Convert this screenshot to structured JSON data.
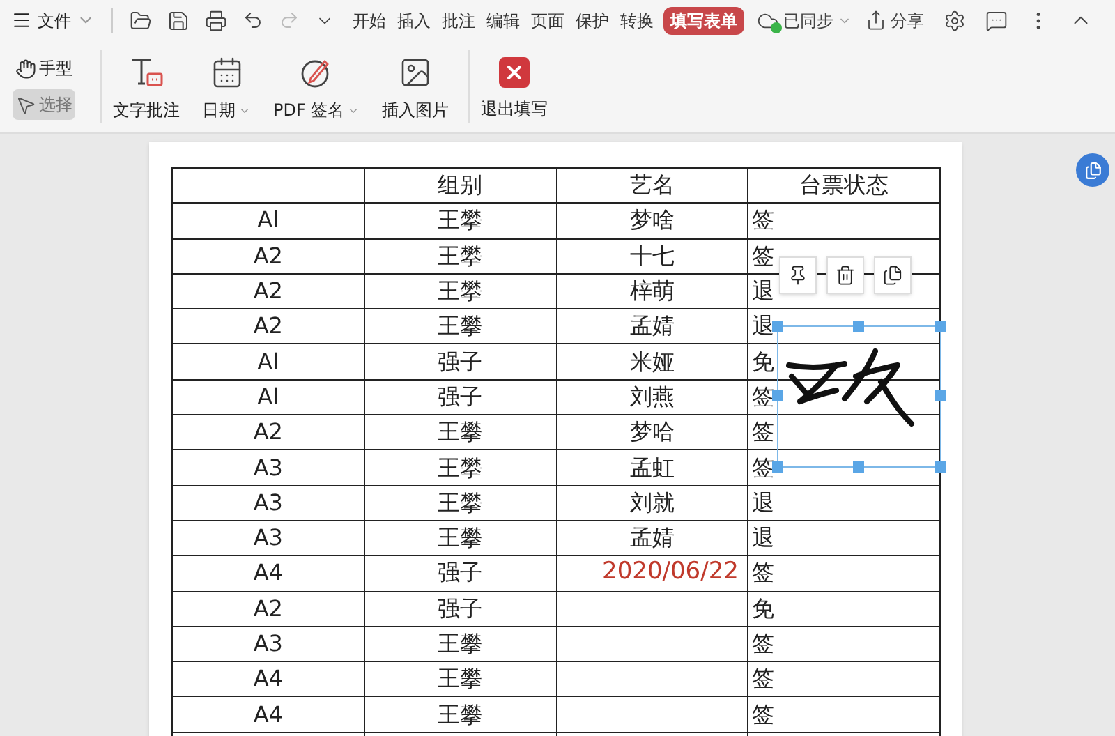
{
  "menu": {
    "label": "文件"
  },
  "tabs": [
    {
      "label": "开始",
      "selected": false
    },
    {
      "label": "插入",
      "selected": false
    },
    {
      "label": "批注",
      "selected": false
    },
    {
      "label": "编辑",
      "selected": false
    },
    {
      "label": "页面",
      "selected": false
    },
    {
      "label": "保护",
      "selected": false
    },
    {
      "label": "转换",
      "selected": false
    },
    {
      "label": "填写表单",
      "selected": true
    }
  ],
  "sync": {
    "label": "已同步"
  },
  "share": {
    "label": "分享"
  },
  "tools": [
    {
      "kind": "hand",
      "label": "手型",
      "selected": false
    },
    {
      "kind": "select",
      "label": "选择",
      "selected": true
    }
  ],
  "actions": [
    {
      "kind": "text-note",
      "label": "文字批注",
      "dropdown": false
    },
    {
      "kind": "date",
      "label": "日期",
      "dropdown": true
    },
    {
      "kind": "signature",
      "label": "PDF 签名",
      "dropdown": true
    },
    {
      "kind": "image",
      "label": "插入图片",
      "dropdown": false
    },
    {
      "kind": "exit",
      "label": "退出填写",
      "dropdown": false
    }
  ],
  "table": {
    "columns": [
      "组别",
      "艺名",
      "台票状态"
    ],
    "rows": [
      {
        "column_1": "Al",
        "group": "王攀",
        "name": "梦啥",
        "status": "签"
      },
      {
        "column_1": "A2",
        "group": "王攀",
        "name": "十七",
        "status": "签"
      },
      {
        "column_1": "A2",
        "group": "王攀",
        "name": "梓萌",
        "status": "退"
      },
      {
        "column_1": "A2",
        "group": "王攀",
        "name": "孟婧",
        "status": "退"
      },
      {
        "column_1": "Al",
        "group": "强子",
        "name": "米娅",
        "status": "免"
      },
      {
        "column_1": "Al",
        "group": "强子",
        "name": "刘燕",
        "status": "签"
      },
      {
        "column_1": "A2",
        "group": "王攀",
        "name": "梦哈",
        "status": "签"
      },
      {
        "column_1": "A3",
        "group": "王攀",
        "name": "孟虹",
        "status": "签"
      },
      {
        "column_1": "A3",
        "group": "王攀",
        "name": "刘就",
        "status": "退"
      },
      {
        "column_1": "A3",
        "group": "王攀",
        "name": "孟婧",
        "status": "退"
      },
      {
        "column_1": "A4",
        "group": "强子",
        "status": "签"
      },
      {
        "column_1": "A2",
        "group": "强子",
        "status": "免"
      },
      {
        "column_1": "A3",
        "group": "王攀",
        "status": "签"
      },
      {
        "column_1": "A4",
        "group": "王攀",
        "status": "签"
      },
      {
        "column_1": "A4",
        "group": "王攀",
        "status": "签"
      }
    ]
  },
  "date_stamp": "2020/06/22"
}
